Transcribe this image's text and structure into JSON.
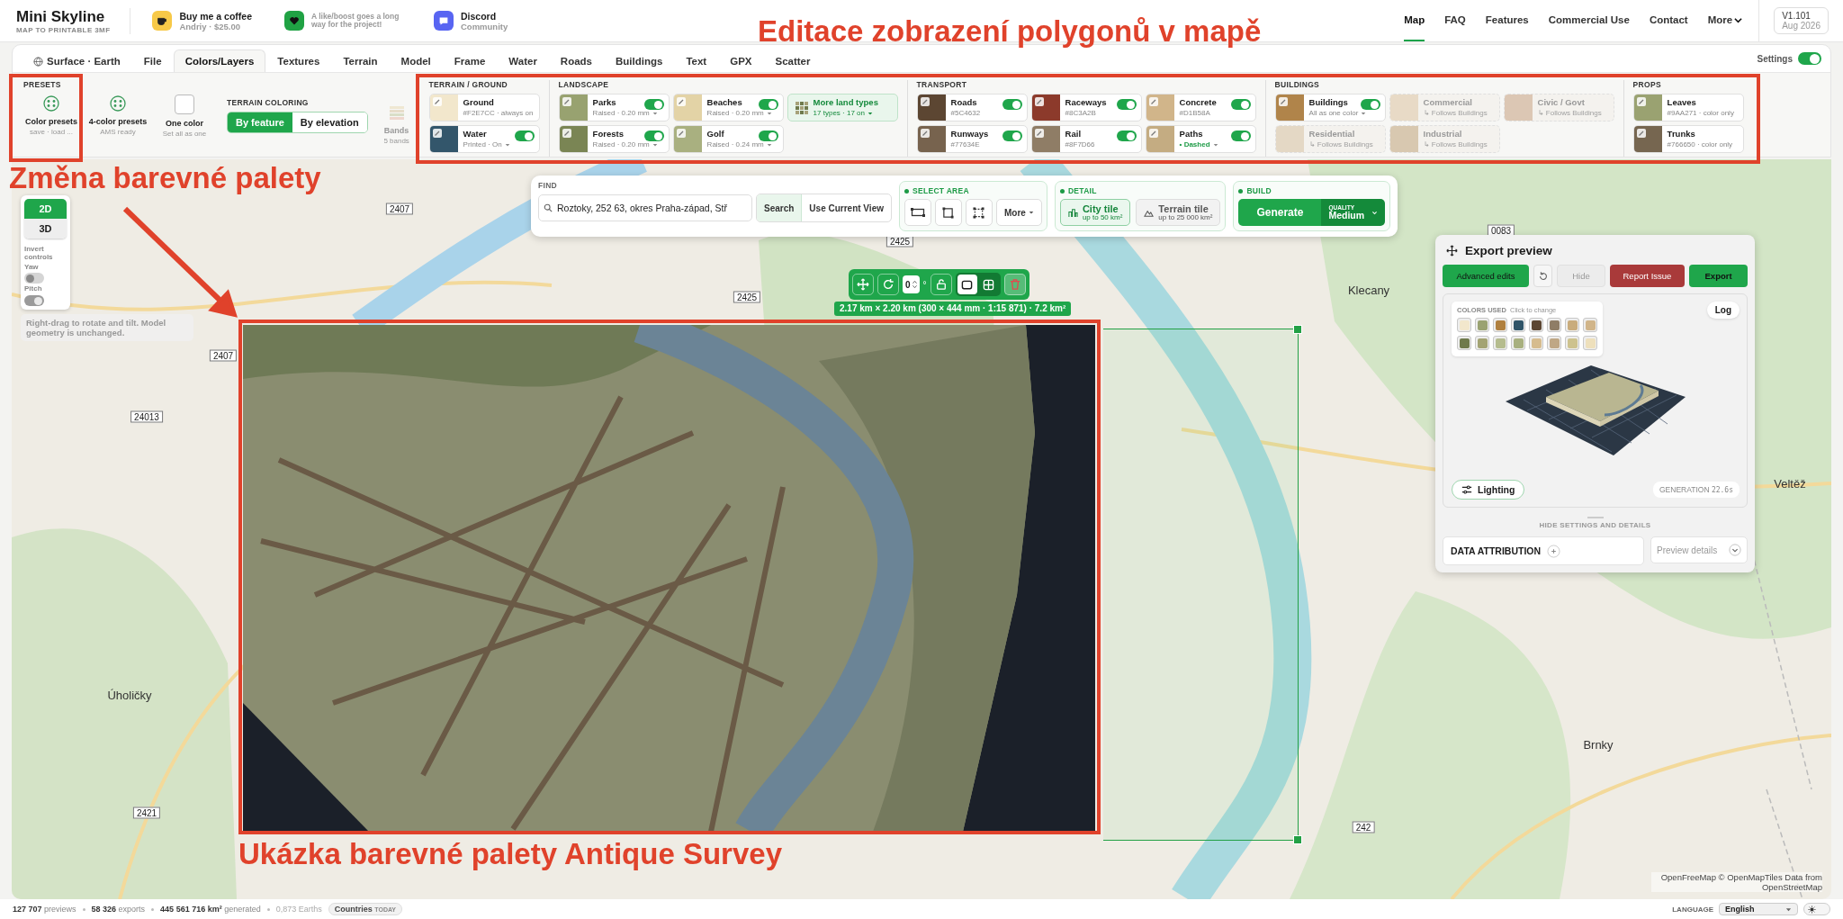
{
  "header": {
    "logo": {
      "title": "Mini Skyline",
      "subtitle": "MAP TO PRINTABLE 3MF"
    },
    "promos": [
      {
        "kind": "coffee",
        "title": "Buy me a coffee",
        "subtitle": "Andriy · $25.00"
      },
      {
        "kind": "boost",
        "title": "A like/boost goes a long way for the project!"
      },
      {
        "kind": "discord",
        "title": "Discord",
        "subtitle": "Community"
      }
    ],
    "nav": [
      {
        "label": "Map",
        "selected": true
      },
      {
        "label": "FAQ",
        "selected": false
      },
      {
        "label": "Features",
        "selected": false
      },
      {
        "label": "Commercial Use",
        "selected": false
      },
      {
        "label": "Contact",
        "selected": false
      },
      {
        "label": "More",
        "selected": false,
        "dropdown": true
      }
    ],
    "version": {
      "label": "V1.101",
      "date": "Aug 2026"
    }
  },
  "tabs": [
    {
      "label": "Surface · Earth",
      "selected": false
    },
    {
      "label": "File",
      "selected": false
    },
    {
      "label": "Colors/Layers",
      "selected": true
    },
    {
      "label": "Textures",
      "selected": false
    },
    {
      "label": "Terrain",
      "selected": false
    },
    {
      "label": "Model",
      "selected": false
    },
    {
      "label": "Frame",
      "selected": false
    },
    {
      "label": "Water",
      "selected": false
    },
    {
      "label": "Roads",
      "selected": false
    },
    {
      "label": "Buildings",
      "selected": false
    },
    {
      "label": "Text",
      "selected": false
    },
    {
      "label": "GPX",
      "selected": false
    },
    {
      "label": "Scatter",
      "selected": false
    }
  ],
  "settings_toggle": {
    "label": "Settings",
    "on": true
  },
  "presets": {
    "heading": "PRESETS",
    "items": [
      {
        "kind": "dots",
        "title": "Color presets",
        "subtitle": "save · load ..."
      },
      {
        "kind": "dots",
        "title": "4-color presets",
        "subtitle": "AMS ready"
      },
      {
        "kind": "blank",
        "title": "One color",
        "subtitle": "Set all as one"
      }
    ]
  },
  "terrain_coloring": {
    "heading": "TERRAIN COLORING",
    "options": [
      {
        "label": "By feature",
        "selected": true
      },
      {
        "label": "By elevation",
        "selected": false
      }
    ]
  },
  "bands": {
    "title": "Bands",
    "subtitle": "5 bands",
    "disabled": true
  },
  "layer_groups": [
    {
      "heading": "TERRAIN / GROUND",
      "layers": [
        {
          "kind": "layer",
          "name": "Ground",
          "detail": "#F2E7CC · always on",
          "color": "#f2e7cc"
        },
        {
          "kind": "layer",
          "name": "Water",
          "detail": "Printed · On",
          "color": "#33566b",
          "on": true,
          "dropdown": true
        }
      ]
    },
    {
      "heading": "LANDSCAPE",
      "layers": [
        {
          "kind": "layer",
          "name": "Parks",
          "detail": "Raised · 0.20 mm",
          "color": "#98a270",
          "on": true,
          "dropdown": true
        },
        {
          "kind": "layer",
          "name": "Forests",
          "detail": "Raised · 0.20 mm",
          "color": "#7a8554",
          "on": true,
          "dropdown": true
        },
        {
          "kind": "layer",
          "name": "Beaches",
          "detail": "Raised · 0.20 mm",
          "color": "#e3d3a6",
          "on": true,
          "dropdown": true
        },
        {
          "kind": "layer",
          "name": "Golf",
          "detail": "Raised · 0.24 mm",
          "color": "#a9b080",
          "on": true,
          "dropdown": true
        },
        {
          "kind": "more",
          "name": "More land types",
          "detail": "17 types · 17 on",
          "dropdown": true
        }
      ]
    },
    {
      "heading": "TRANSPORT",
      "layers": [
        {
          "kind": "layer",
          "name": "Roads",
          "detail": "#5C4632",
          "color": "#5c4632",
          "on": true
        },
        {
          "kind": "layer",
          "name": "Runways",
          "detail": "#77634E",
          "color": "#77634e",
          "on": true
        },
        {
          "kind": "layer",
          "name": "Raceways",
          "detail": "#8C3A2B",
          "color": "#8c3a2b",
          "on": true
        },
        {
          "kind": "layer",
          "name": "Rail",
          "detail": "#8F7D66",
          "color": "#8f7d66",
          "on": true
        },
        {
          "kind": "layer",
          "name": "Concrete",
          "detail": "#D1B58A",
          "color": "#d1b58a",
          "on": true
        },
        {
          "kind": "layer",
          "name": "Paths",
          "detail": "• Dashed",
          "color": "#c4ac82",
          "on": true,
          "dropdown": true,
          "accent": true
        }
      ]
    },
    {
      "heading": "BUILDINGS",
      "layers": [
        {
          "kind": "layer",
          "name": "Buildings",
          "detail": "All as one color",
          "color": "#b0844a",
          "on": true,
          "dropdown": true
        },
        {
          "kind": "follow",
          "name": "Residential",
          "detail": "↳ Follows Buildings",
          "color": "#e4d8c5"
        },
        {
          "kind": "follow",
          "name": "Commercial",
          "detail": "↳ Follows Buildings",
          "color": "#e8dac6"
        },
        {
          "kind": "follow",
          "name": "Industrial",
          "detail": "↳ Follows Buildings",
          "color": "#d8c8b0"
        },
        {
          "kind": "follow",
          "name": "Civic / Govt",
          "detail": "↳ Follows Buildings",
          "color": "#dcc7b4"
        }
      ]
    },
    {
      "heading": "PROPS",
      "layers": [
        {
          "kind": "layer",
          "name": "Leaves",
          "detail": "#9AA271 · color only",
          "color": "#9aa271"
        },
        {
          "kind": "layer",
          "name": "Trunks",
          "detail": "#766650 · color only",
          "color": "#766650"
        }
      ]
    }
  ],
  "map_controls": {
    "view_modes": [
      {
        "label": "2D",
        "selected": true
      },
      {
        "label": "3D",
        "selected": false
      }
    ],
    "invert_label": "Invert controls",
    "toggles": [
      {
        "label": "Yaw",
        "on": false
      },
      {
        "label": "Pitch",
        "on": true
      }
    ],
    "hint": "Right-drag to rotate and tilt. Model geometry is unchanged."
  },
  "find": {
    "heading": "FIND",
    "value": "Roztoky, 252 63, okres Praha-západ, Stř",
    "search": "Search",
    "current_view": "Use Current View"
  },
  "select_area": {
    "heading": "SELECT AREA",
    "more": "More"
  },
  "detail": {
    "heading": "DETAIL",
    "options": [
      {
        "kind": "city",
        "title": "City tile",
        "subtitle": "up to 50 km²",
        "selected": true
      },
      {
        "kind": "terrain",
        "title": "Terrain tile",
        "subtitle": "up to 25 000 km²",
        "selected": false
      }
    ]
  },
  "build": {
    "heading": "BUILD",
    "generate": "Generate",
    "quality_label": "QUALITY",
    "quality": "Medium"
  },
  "selection_toolbar": {
    "rotation": "0",
    "unit": "°",
    "modes": [
      {
        "kind": "single",
        "selected": true
      },
      {
        "kind": "grid",
        "selected": false
      }
    ]
  },
  "selection_size": "2.17 km × 2.20 km (300 × 444 mm · 1:15 871) · 7.2 km²",
  "map_labels": [
    {
      "text": "2407",
      "kind": "road"
    },
    {
      "text": "2425",
      "kind": "road"
    },
    {
      "text": "2425",
      "kind": "road"
    },
    {
      "text": "0083",
      "kind": "road"
    },
    {
      "text": "2407",
      "kind": "road"
    },
    {
      "text": "24013",
      "kind": "road"
    },
    {
      "text": "2421",
      "kind": "road"
    },
    {
      "text": "242",
      "kind": "road"
    },
    {
      "text": "Klecany",
      "kind": "place"
    },
    {
      "text": "Úholičky",
      "kind": "place"
    },
    {
      "text": "Veltěž",
      "kind": "place"
    },
    {
      "text": "Brnky",
      "kind": "place"
    }
  ],
  "attribution": "OpenFreeMap © OpenMapTiles Data from OpenStreetMap",
  "export_preview": {
    "title": "Export preview",
    "buttons": [
      {
        "kind": "primary",
        "label": "Advanced edits"
      },
      {
        "kind": "reset"
      },
      {
        "kind": "disabled",
        "label": "Hide"
      },
      {
        "kind": "danger",
        "label": "Report Issue"
      },
      {
        "kind": "primary",
        "label": "Export"
      }
    ],
    "colors_heading": "COLORS USED",
    "colors_hint": "Click to change",
    "colors": [
      {
        "color": "#f2e7cc"
      },
      {
        "color": "#9aa271"
      },
      {
        "color": "#b0803f"
      },
      {
        "color": "#2f5468"
      },
      {
        "color": "#5c4632"
      },
      {
        "color": "#8f7d66"
      },
      {
        "color": "#c9ac7c"
      },
      {
        "color": "#d1b58a"
      },
      {
        "color": "#6f7a4c"
      },
      {
        "color": "#a3a373"
      },
      {
        "color": "#b5bc8e"
      },
      {
        "color": "#a8b07f"
      },
      {
        "color": "#d6bc8f"
      },
      {
        "color": "#bfa785"
      },
      {
        "color": "#cdc28e"
      },
      {
        "color": "#eee0bc"
      }
    ],
    "log": "Log",
    "lighting": "Lighting",
    "generation_label": "GENERATION",
    "generation_time": "22.6s",
    "hide_settings": "HIDE SETTINGS AND DETAILS",
    "data_attribution": "DATA ATTRIBUTION",
    "preview_details": "Preview details"
  },
  "footer": {
    "stats": [
      {
        "text": "**127 707** previews"
      },
      {
        "text": "**58 326** exports"
      },
      {
        "text": "**445 561 716 km²** generated"
      }
    ],
    "earths": "0,873 Earths",
    "countries": {
      "label": "Countries",
      "badge": "TODAY"
    },
    "language_label": "LANGUAGE",
    "language": "English",
    "dark_mode": false
  },
  "annotations": [
    {
      "text": "Editace zobrazení polygonů v mapě"
    },
    {
      "text": "Změna barevné palety"
    },
    {
      "text": "Ukázka barevné palety Antique Survey"
    }
  ]
}
